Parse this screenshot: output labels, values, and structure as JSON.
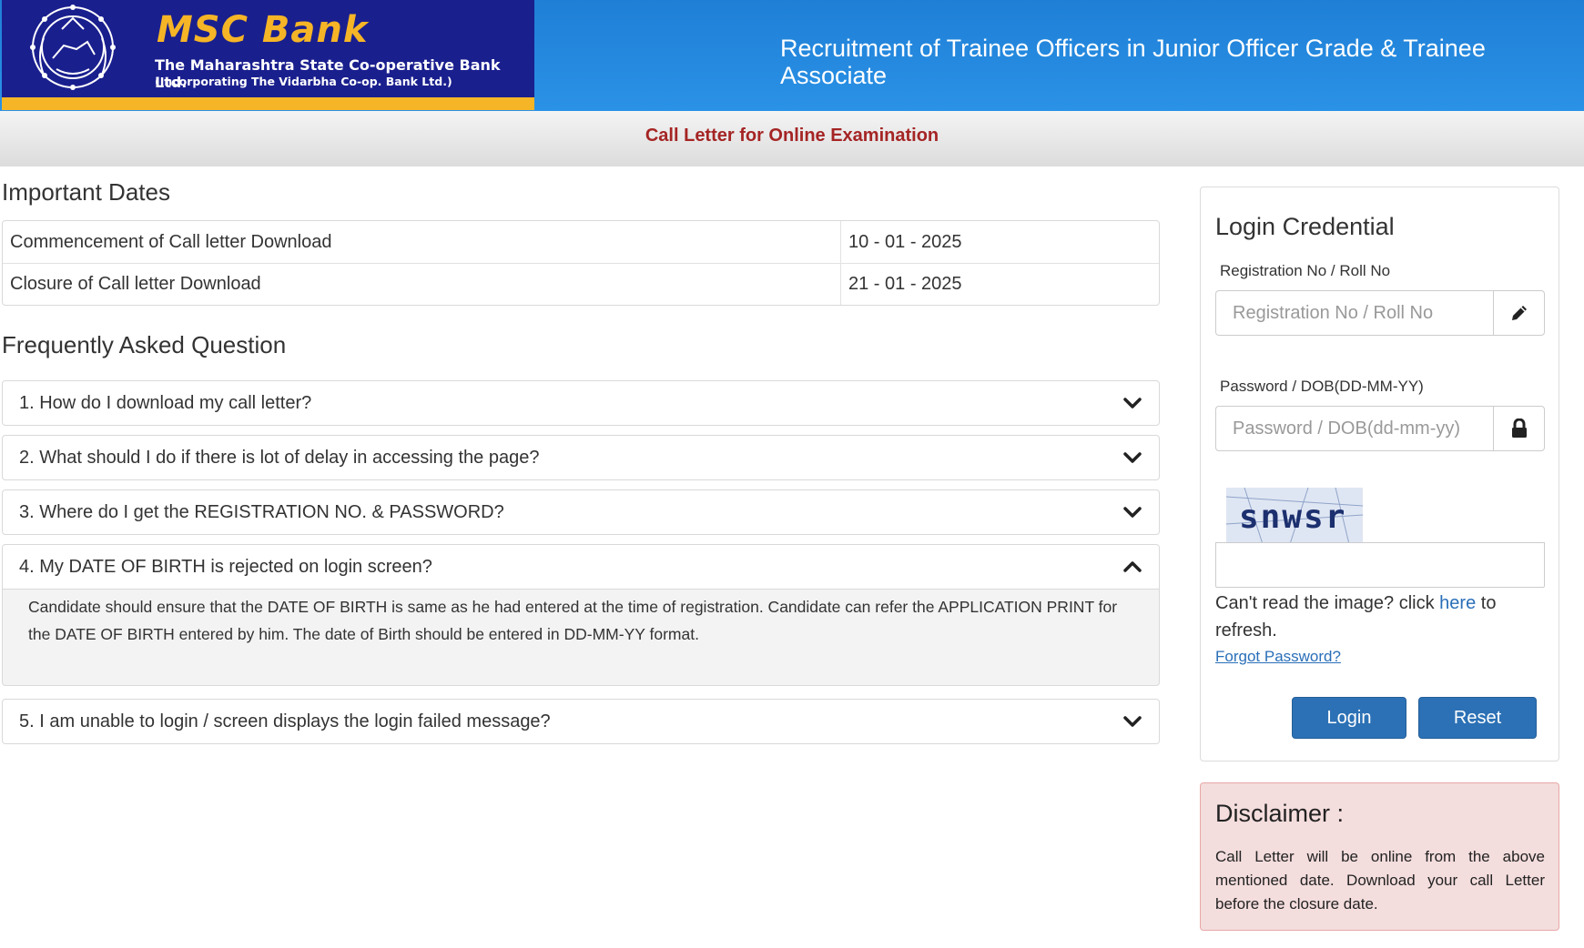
{
  "header": {
    "bank_name": "MSC Bank",
    "bank_full_name": "The Maharashtra State Co-operative Bank Ltd.",
    "bank_incorporating": "(Incorporating The Vidarbha Co-op. Bank Ltd.)",
    "title": "Recruitment of Trainee Officers in Junior Officer Grade & Trainee Associate"
  },
  "subbar": {
    "title": "Call Letter for Online Examination"
  },
  "important_dates": {
    "heading": "Important Dates",
    "rows": [
      {
        "label": "Commencement of Call letter Download",
        "value": "10 - 01 - 2025"
      },
      {
        "label": "Closure of Call letter Download",
        "value": "21 - 01 - 2025"
      }
    ]
  },
  "faq": {
    "heading": "Frequently Asked Question",
    "items": [
      {
        "question": "1. How do I download my call letter?",
        "expanded": false
      },
      {
        "question": "2. What should I do if there is lot of delay in accessing the page?",
        "expanded": false
      },
      {
        "question": "3. Where do I get the REGISTRATION NO. & PASSWORD?",
        "expanded": false
      },
      {
        "question": "4. My DATE OF BIRTH is rejected on login screen?",
        "expanded": true,
        "answer": "Candidate should ensure that the DATE OF BIRTH is same as he had entered at the time of registration. Candidate can refer the APPLICATION PRINT for the DATE OF BIRTH entered by him. The date of Birth should be entered in DD-MM-YY format."
      },
      {
        "question": "5. I am unable to login / screen displays the login failed message?",
        "expanded": false
      }
    ]
  },
  "login": {
    "title": "Login Credential",
    "registration_label": "Registration No / Roll No",
    "registration_placeholder": "Registration No / Roll No",
    "registration_value": "",
    "password_label": "Password / DOB(DD-MM-YY)",
    "password_placeholder": "Password / DOB(dd-mm-yy)",
    "password_value": "",
    "captcha_text": "snwsr",
    "captcha_value": "",
    "refresh_prefix": "Can't read the image? click ",
    "refresh_link": "here",
    "refresh_suffix": " to refresh.",
    "forgot_password": "Forgot Password?",
    "login_button": "Login",
    "reset_button": "Reset",
    "icons": {
      "registration": "pencil-icon",
      "password": "lock-icon"
    }
  },
  "disclaimer": {
    "title": "Disclaimer :",
    "text": "Call Letter will be online from the above mentioned date. Download your call Letter before the closure date."
  },
  "colors": {
    "header_blue": "#2a92e6",
    "logo_navy": "#1a1f8e",
    "logo_gold": "#f5b526",
    "subbar_title": "#a52424",
    "button_blue": "#2c71b5",
    "link_blue": "#2a6fb8",
    "disclaimer_bg": "#f4dddd",
    "disclaimer_border": "#e8a7a7"
  }
}
